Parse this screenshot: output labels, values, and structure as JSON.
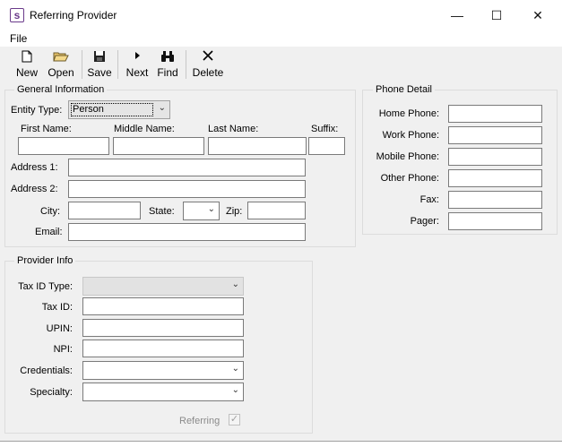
{
  "window": {
    "title": "Referring Provider",
    "app_icon": "s",
    "minimize": "—",
    "maximize": "☐",
    "close": "✕"
  },
  "menu": {
    "file": "File"
  },
  "toolbar": {
    "new": "New",
    "open": "Open",
    "save": "Save",
    "next": "Next",
    "find": "Find",
    "delete": "Delete"
  },
  "general": {
    "title": "General Information",
    "entity_type_label": "Entity Type:",
    "entity_type_value": "Person",
    "first_name_label": "First Name:",
    "middle_name_label": "Middle Name:",
    "last_name_label": "Last Name:",
    "suffix_label": "Suffix:",
    "address1_label": "Address 1:",
    "address2_label": "Address 2:",
    "city_label": "City:",
    "state_label": "State:",
    "zip_label": "Zip:",
    "email_label": "Email:"
  },
  "phone": {
    "title": "Phone Detail",
    "home_label": "Home Phone:",
    "work_label": "Work Phone:",
    "mobile_label": "Mobile Phone:",
    "other_label": "Other Phone:",
    "fax_label": "Fax:",
    "pager_label": "Pager:"
  },
  "provider": {
    "title": "Provider Info",
    "tax_id_type_label": "Tax ID Type:",
    "tax_id_label": "Tax ID:",
    "upin_label": "UPIN:",
    "npi_label": "NPI:",
    "credentials_label": "Credentials:",
    "specialty_label": "Specialty:",
    "referring_label": "Referring",
    "referring_checked": true
  }
}
